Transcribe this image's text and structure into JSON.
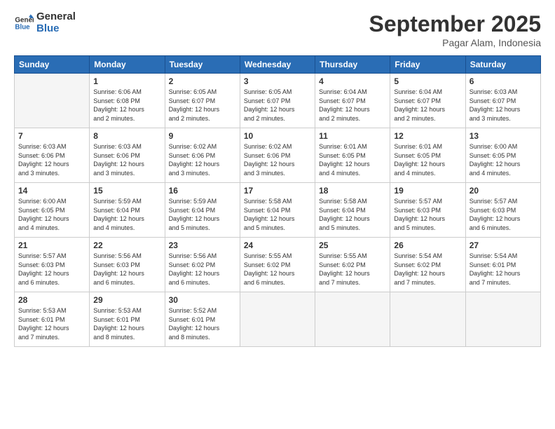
{
  "header": {
    "logo_line1": "General",
    "logo_line2": "Blue",
    "month": "September 2025",
    "location": "Pagar Alam, Indonesia"
  },
  "weekdays": [
    "Sunday",
    "Monday",
    "Tuesday",
    "Wednesday",
    "Thursday",
    "Friday",
    "Saturday"
  ],
  "weeks": [
    [
      {
        "day": "",
        "info": ""
      },
      {
        "day": "1",
        "info": "Sunrise: 6:06 AM\nSunset: 6:08 PM\nDaylight: 12 hours\nand 2 minutes."
      },
      {
        "day": "2",
        "info": "Sunrise: 6:05 AM\nSunset: 6:07 PM\nDaylight: 12 hours\nand 2 minutes."
      },
      {
        "day": "3",
        "info": "Sunrise: 6:05 AM\nSunset: 6:07 PM\nDaylight: 12 hours\nand 2 minutes."
      },
      {
        "day": "4",
        "info": "Sunrise: 6:04 AM\nSunset: 6:07 PM\nDaylight: 12 hours\nand 2 minutes."
      },
      {
        "day": "5",
        "info": "Sunrise: 6:04 AM\nSunset: 6:07 PM\nDaylight: 12 hours\nand 2 minutes."
      },
      {
        "day": "6",
        "info": "Sunrise: 6:03 AM\nSunset: 6:07 PM\nDaylight: 12 hours\nand 3 minutes."
      }
    ],
    [
      {
        "day": "7",
        "info": "Sunrise: 6:03 AM\nSunset: 6:06 PM\nDaylight: 12 hours\nand 3 minutes."
      },
      {
        "day": "8",
        "info": "Sunrise: 6:03 AM\nSunset: 6:06 PM\nDaylight: 12 hours\nand 3 minutes."
      },
      {
        "day": "9",
        "info": "Sunrise: 6:02 AM\nSunset: 6:06 PM\nDaylight: 12 hours\nand 3 minutes."
      },
      {
        "day": "10",
        "info": "Sunrise: 6:02 AM\nSunset: 6:06 PM\nDaylight: 12 hours\nand 3 minutes."
      },
      {
        "day": "11",
        "info": "Sunrise: 6:01 AM\nSunset: 6:05 PM\nDaylight: 12 hours\nand 4 minutes."
      },
      {
        "day": "12",
        "info": "Sunrise: 6:01 AM\nSunset: 6:05 PM\nDaylight: 12 hours\nand 4 minutes."
      },
      {
        "day": "13",
        "info": "Sunrise: 6:00 AM\nSunset: 6:05 PM\nDaylight: 12 hours\nand 4 minutes."
      }
    ],
    [
      {
        "day": "14",
        "info": "Sunrise: 6:00 AM\nSunset: 6:05 PM\nDaylight: 12 hours\nand 4 minutes."
      },
      {
        "day": "15",
        "info": "Sunrise: 5:59 AM\nSunset: 6:04 PM\nDaylight: 12 hours\nand 4 minutes."
      },
      {
        "day": "16",
        "info": "Sunrise: 5:59 AM\nSunset: 6:04 PM\nDaylight: 12 hours\nand 5 minutes."
      },
      {
        "day": "17",
        "info": "Sunrise: 5:58 AM\nSunset: 6:04 PM\nDaylight: 12 hours\nand 5 minutes."
      },
      {
        "day": "18",
        "info": "Sunrise: 5:58 AM\nSunset: 6:04 PM\nDaylight: 12 hours\nand 5 minutes."
      },
      {
        "day": "19",
        "info": "Sunrise: 5:57 AM\nSunset: 6:03 PM\nDaylight: 12 hours\nand 5 minutes."
      },
      {
        "day": "20",
        "info": "Sunrise: 5:57 AM\nSunset: 6:03 PM\nDaylight: 12 hours\nand 6 minutes."
      }
    ],
    [
      {
        "day": "21",
        "info": "Sunrise: 5:57 AM\nSunset: 6:03 PM\nDaylight: 12 hours\nand 6 minutes."
      },
      {
        "day": "22",
        "info": "Sunrise: 5:56 AM\nSunset: 6:03 PM\nDaylight: 12 hours\nand 6 minutes."
      },
      {
        "day": "23",
        "info": "Sunrise: 5:56 AM\nSunset: 6:02 PM\nDaylight: 12 hours\nand 6 minutes."
      },
      {
        "day": "24",
        "info": "Sunrise: 5:55 AM\nSunset: 6:02 PM\nDaylight: 12 hours\nand 6 minutes."
      },
      {
        "day": "25",
        "info": "Sunrise: 5:55 AM\nSunset: 6:02 PM\nDaylight: 12 hours\nand 7 minutes."
      },
      {
        "day": "26",
        "info": "Sunrise: 5:54 AM\nSunset: 6:02 PM\nDaylight: 12 hours\nand 7 minutes."
      },
      {
        "day": "27",
        "info": "Sunrise: 5:54 AM\nSunset: 6:01 PM\nDaylight: 12 hours\nand 7 minutes."
      }
    ],
    [
      {
        "day": "28",
        "info": "Sunrise: 5:53 AM\nSunset: 6:01 PM\nDaylight: 12 hours\nand 7 minutes."
      },
      {
        "day": "29",
        "info": "Sunrise: 5:53 AM\nSunset: 6:01 PM\nDaylight: 12 hours\nand 8 minutes."
      },
      {
        "day": "30",
        "info": "Sunrise: 5:52 AM\nSunset: 6:01 PM\nDaylight: 12 hours\nand 8 minutes."
      },
      {
        "day": "",
        "info": ""
      },
      {
        "day": "",
        "info": ""
      },
      {
        "day": "",
        "info": ""
      },
      {
        "day": "",
        "info": ""
      }
    ]
  ]
}
